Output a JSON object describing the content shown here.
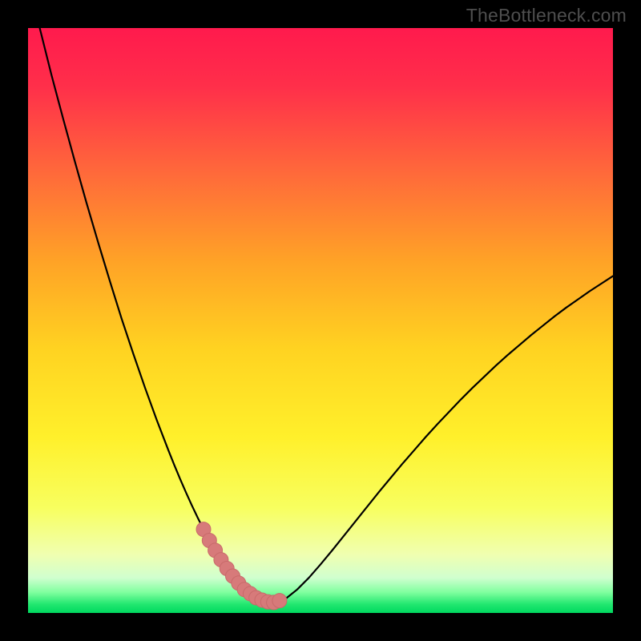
{
  "watermark": "TheBottleneck.com",
  "colors": {
    "frame": "#000000",
    "gradient_stops": [
      {
        "offset": 0.0,
        "color": "#ff1a4d"
      },
      {
        "offset": 0.1,
        "color": "#ff2f4a"
      },
      {
        "offset": 0.25,
        "color": "#ff6a3a"
      },
      {
        "offset": 0.4,
        "color": "#ffa326"
      },
      {
        "offset": 0.55,
        "color": "#ffd321"
      },
      {
        "offset": 0.7,
        "color": "#fff02b"
      },
      {
        "offset": 0.82,
        "color": "#f8ff5f"
      },
      {
        "offset": 0.9,
        "color": "#f0ffb0"
      },
      {
        "offset": 0.94,
        "color": "#d0ffcf"
      },
      {
        "offset": 0.965,
        "color": "#7fff9e"
      },
      {
        "offset": 0.985,
        "color": "#22e770"
      },
      {
        "offset": 1.0,
        "color": "#00d95f"
      }
    ],
    "curve": "#000000",
    "marker_fill": "#d77a7a",
    "marker_stroke": "#c86a6a"
  },
  "chart_data": {
    "type": "line",
    "title": "",
    "xlabel": "",
    "ylabel": "",
    "xlim": [
      0,
      100
    ],
    "ylim": [
      0,
      100
    ],
    "grid": false,
    "series": [
      {
        "name": "bottleneck-curve",
        "x": [
          2,
          4,
          6,
          8,
          10,
          12,
          14,
          16,
          18,
          20,
          22,
          24,
          25,
          26,
          27,
          28,
          29,
          30,
          31,
          32,
          33,
          34,
          35,
          36,
          38,
          40,
          42,
          44,
          46,
          48,
          50,
          52,
          54,
          56,
          58,
          60,
          62,
          64,
          66,
          68,
          70,
          72,
          74,
          76,
          78,
          80,
          82,
          84,
          86,
          88,
          90,
          92,
          94,
          96,
          98,
          100
        ],
        "y": [
          100,
          92,
          84.5,
          77.2,
          70.1,
          63.3,
          56.7,
          50.3,
          44.3,
          38.5,
          33,
          27.8,
          25.3,
          22.9,
          20.6,
          18.4,
          16.3,
          14.3,
          12.4,
          10.7,
          9.1,
          7.6,
          6.3,
          5.1,
          3.3,
          2.2,
          1.8,
          2.4,
          4.0,
          6.0,
          8.3,
          10.7,
          13.2,
          15.7,
          18.2,
          20.7,
          23.1,
          25.5,
          27.8,
          30.1,
          32.3,
          34.4,
          36.5,
          38.5,
          40.4,
          42.3,
          44.1,
          45.8,
          47.5,
          49.1,
          50.7,
          52.2,
          53.6,
          55.0,
          56.3,
          57.6
        ]
      }
    ],
    "markers": {
      "name": "highlight-region",
      "x": [
        30,
        31,
        32,
        33,
        34,
        35,
        36,
        37,
        38,
        39,
        40,
        41,
        42,
        43
      ],
      "y": [
        14.3,
        12.4,
        10.7,
        9.1,
        7.6,
        6.3,
        5.1,
        4.0,
        3.3,
        2.6,
        2.2,
        1.9,
        1.8,
        2.1
      ]
    }
  }
}
